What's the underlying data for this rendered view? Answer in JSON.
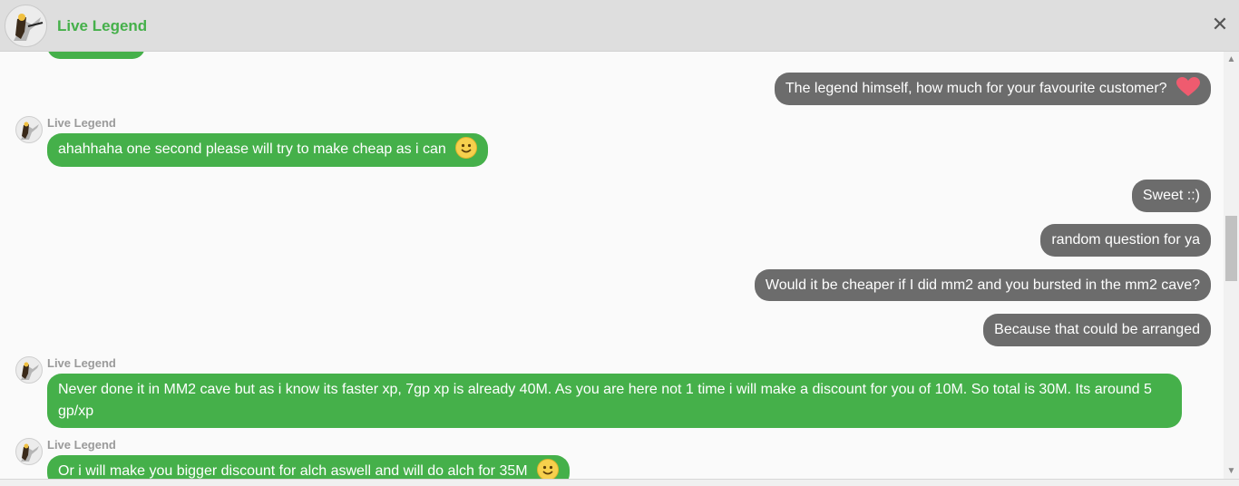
{
  "header": {
    "contact_name": "Live Legend",
    "close_label": "✕"
  },
  "messages": [
    {
      "text": "The legend himself, how much for your favourite customer?"
    },
    {
      "sender": "Live Legend",
      "text": "ahahhaha one second please will try to make cheap as i can"
    },
    {
      "text": "Sweet ::)"
    },
    {
      "text": "random question for ya"
    },
    {
      "text": "Would it be cheaper if I did mm2 and you bursted in the mm2 cave?"
    },
    {
      "text": "Because that could be arranged"
    },
    {
      "sender": "Live Legend",
      "text": "Never done it in MM2 cave but as i know its faster xp, 7gp xp is already 40M. As you are here not 1 time i will make a discount for you of 10M. So total is 30M. Its around 5 gp/xp"
    },
    {
      "sender": "Live Legend",
      "text": "Or i will make you bigger discount for alch aswell and will do alch for 35M"
    }
  ],
  "colors": {
    "incoming": "#45b04a",
    "outgoing": "#6c6c6c",
    "header": "#dedede"
  },
  "icons": {
    "heart": "heart-icon",
    "smile": "smiley-icon",
    "close": "close-icon"
  }
}
